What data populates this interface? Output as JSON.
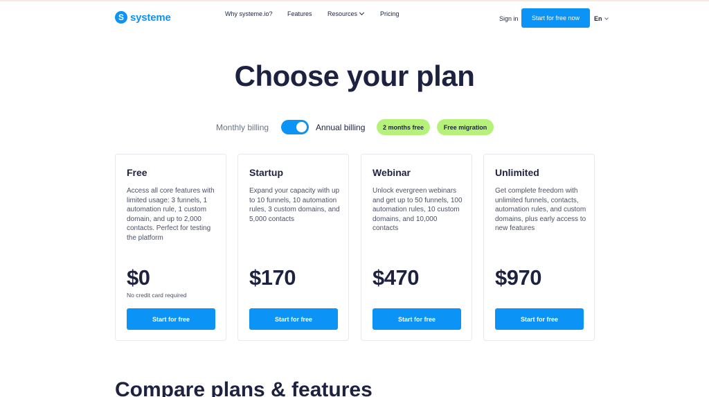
{
  "brand": {
    "logo_letter": "S",
    "name": "systeme",
    "accent": "#0b93f6"
  },
  "nav": {
    "items": [
      {
        "label": "Why systeme.io?"
      },
      {
        "label": "Features"
      },
      {
        "label": "Resources",
        "has_dropdown": true
      },
      {
        "label": "Pricing"
      }
    ],
    "signin_label": "Sign in",
    "cta_label": "Start for free now",
    "language": "En"
  },
  "hero": {
    "title": "Choose your plan"
  },
  "billing": {
    "monthly_label": "Monthly billing",
    "annual_label": "Annual billing",
    "annual_selected": true,
    "badges": [
      "2 months free",
      "Free migration"
    ],
    "badge_color": "#b6f27a"
  },
  "plans": [
    {
      "name": "Free",
      "description": "Access all core features with limited usage: 3 funnels, 1 automation rule, 1 custom domain, and up to 2,000 contacts. Perfect for testing the platform",
      "price": "$0",
      "note": "No credit card required",
      "button": "Start for free"
    },
    {
      "name": "Startup",
      "description": "Expand your capacity with up to 10 funnels, 10 automation rules, 3 custom domains, and 5,000 contacts",
      "price": "$170",
      "note": "",
      "button": "Start for free"
    },
    {
      "name": "Webinar",
      "description": "Unlock evergreen webinars and get up to 50 funnels, 100 automation rules, 10 custom domains, and 10,000 contacts",
      "price": "$470",
      "note": "",
      "button": "Start for free"
    },
    {
      "name": "Unlimited",
      "description": "Get complete freedom with unlimited funnels, contacts, automation rules, and custom domains, plus early access to new features",
      "price": "$970",
      "note": "",
      "button": "Start for free"
    }
  ],
  "compare": {
    "title": "Compare plans & features"
  }
}
